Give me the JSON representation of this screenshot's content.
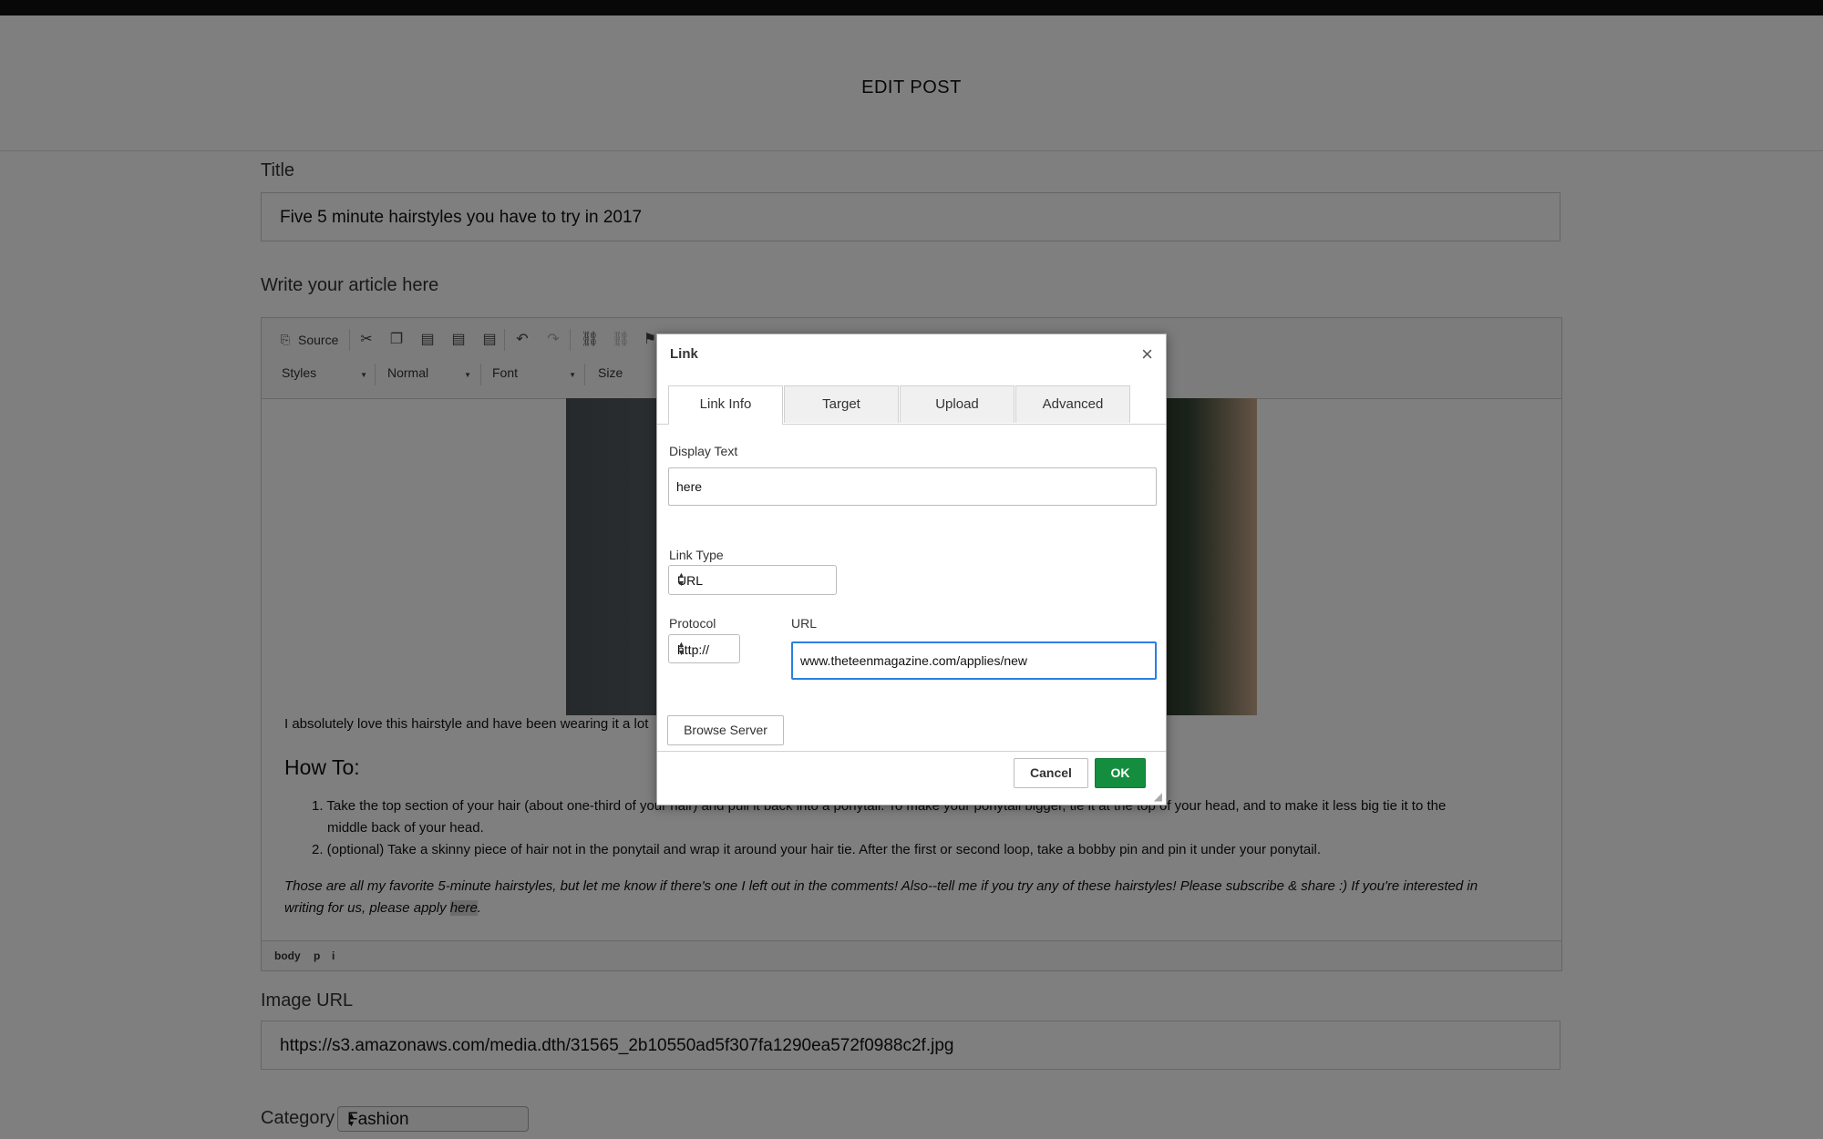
{
  "header": {
    "title": "EDIT POST"
  },
  "title_field": {
    "label": "Title",
    "value": "Five 5 minute hairstyles you have to try in 2017"
  },
  "article": {
    "label": "Write your article here",
    "toolbar": {
      "source_label": "Source",
      "styles": "Styles",
      "format": "Normal",
      "font": "Font",
      "size": "Size"
    },
    "paragraph1": "I absolutely love this hairstyle and have been wearing it a lot",
    "heading": "How To:",
    "steps": [
      "1. Take the top section of your hair (about one-third of your hair) and pull it back into a ponytail. To make your ponytail bigger, tie it at the top of your head, and to make it less big tie it to the",
      "middle back of your head.",
      "2. (optional) Take a skinny piece of hair not in the ponytail and wrap it around your hair tie. After the first or second loop, take a bobby pin and pin it under your ponytail."
    ],
    "closing_line1": "Those are all my favorite 5-minute hairstyles, but let me know if there's one I left out in the comments! Also--tell me if you try any of these hairstyles! Please subscribe & share :) If you're interested in",
    "closing_line2_pre": "writing for us, please apply ",
    "closing_link": "here",
    "closing_end": ".",
    "path": [
      "body",
      "p",
      "i"
    ]
  },
  "image_url": {
    "label": "Image URL",
    "value": "https://s3.amazonaws.com/media.dth/31565_2b10550ad5f307fa1290ea572f0988c2f.jpg"
  },
  "category": {
    "label": "Category",
    "value": "Fashion"
  },
  "dialog": {
    "title": "Link",
    "close": "×",
    "tabs": [
      "Link Info",
      "Target",
      "Upload",
      "Advanced"
    ],
    "display_text_label": "Display Text",
    "display_text_value": "here",
    "link_type_label": "Link Type",
    "link_type_value": "URL",
    "protocol_label": "Protocol",
    "protocol_value": "http://",
    "url_label": "URL",
    "url_value": "www.theteenmagazine.com/applies/new",
    "browse_label": "Browse Server",
    "cancel_label": "Cancel",
    "ok_label": "OK"
  },
  "colors": {
    "ok_button": "#158d3f",
    "focus_border": "#2a7fe0",
    "overlay": "rgba(0,0,0,0.5)"
  }
}
